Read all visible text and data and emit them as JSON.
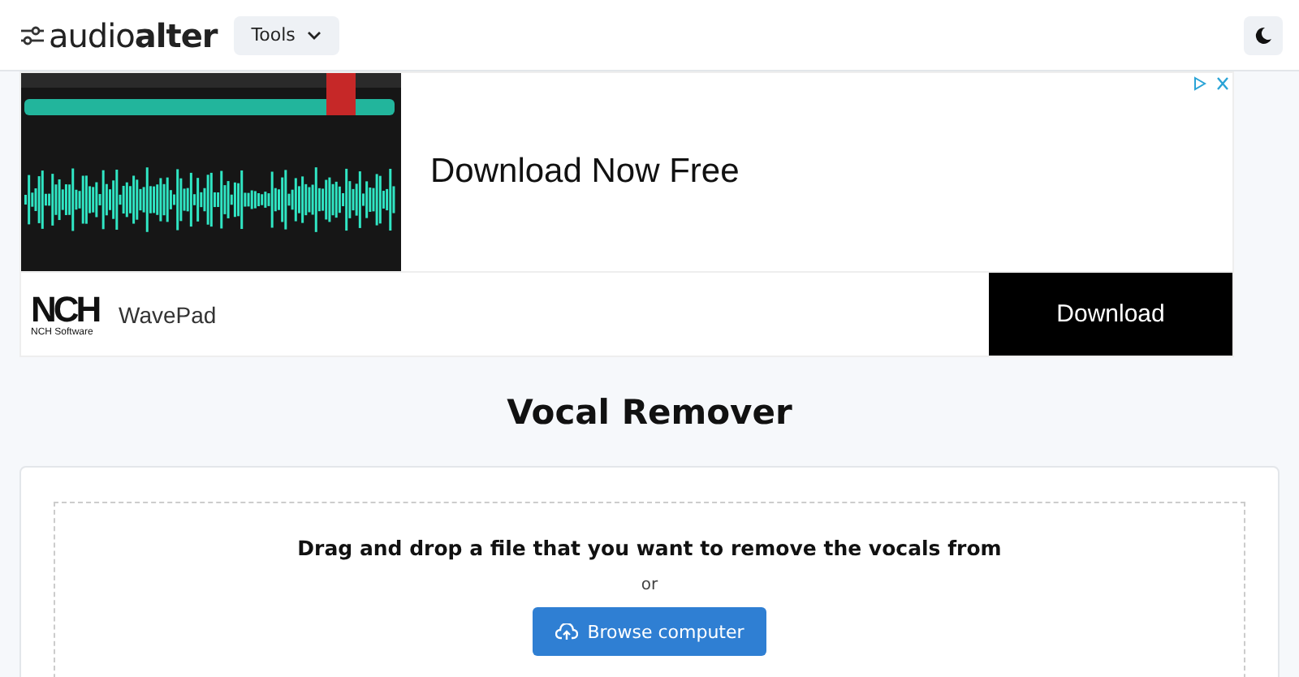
{
  "header": {
    "logo": "audio**alter**",
    "tools_menu": {
      "label": "Tools",
      "expanded": false
    }
  },
  "ad": {
    "headline": "Download Now Free",
    "brand_logo": "NCH",
    "brand_caption": "NCH Software",
    "product": "WavePad",
    "button": "Download"
  },
  "page_title": "Vocal Remover",
  "upload": {
    "prompt": "Drag and drop a file that you want to remove the vocals from",
    "separator": "or",
    "button": "Browse computer"
  }
}
